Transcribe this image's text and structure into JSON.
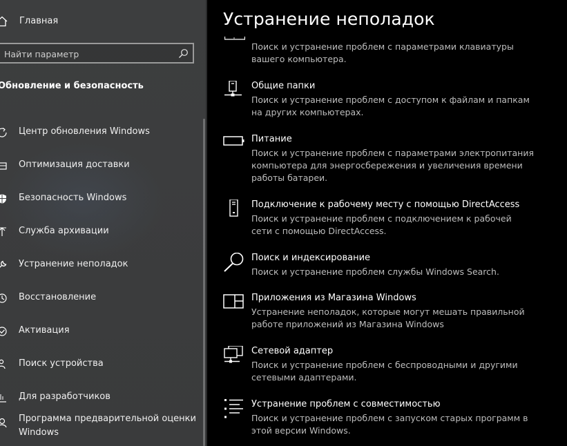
{
  "sidebar": {
    "home_label": "Главная",
    "search_placeholder": "Найти параметр",
    "section_title": "Обновление и безопасность",
    "items": [
      {
        "label": "Центр обновления Windows",
        "icon": "refresh-icon"
      },
      {
        "label": "Оптимизация доставки",
        "icon": "delivery-optimization-icon"
      },
      {
        "label": "Безопасность Windows",
        "icon": "shield-icon"
      },
      {
        "label": "Служба архивации",
        "icon": "backup-arrow-icon"
      },
      {
        "label": "Устранение неполадок",
        "icon": "wrench-icon"
      },
      {
        "label": "Восстановление",
        "icon": "recovery-icon"
      },
      {
        "label": "Активация",
        "icon": "check-circle-icon"
      },
      {
        "label": "Поиск устройства",
        "icon": "person-location-icon"
      },
      {
        "label": "Для разработчиков",
        "icon": "developer-icon"
      },
      {
        "label": "Программа предварительной оценки Windows",
        "icon": "insider-icon"
      }
    ]
  },
  "main": {
    "title": "Устранение неполадок",
    "top_description": "Поиск и устранение проблем с параметрами клавиатуры вашего компьютера.",
    "troubleshooters": [
      {
        "title": "Общие папки",
        "description": "Поиск и устранение проблем с доступом к файлам и папкам на других компьютерах.",
        "icon": "shared-folders-icon"
      },
      {
        "title": "Питание",
        "description": "Поиск и устранение проблем с параметрами электропитания компьютера для энергосбережения и увеличения  времени работы батареи.",
        "icon": "battery-icon"
      },
      {
        "title": "Подключение к рабочему месту с помощью DirectAccess",
        "description": "Поиск и устранение проблем с подключением к рабочей сети с помощью DirectAccess.",
        "icon": "directaccess-icon"
      },
      {
        "title": "Поиск и индексирование",
        "description": "Поиск и устранение проблем службы Windows Search.",
        "icon": "search-icon"
      },
      {
        "title": "Приложения из Магазина Windows",
        "description": "Устранение неполадок, которые могут мешать правильной работе приложений из Магазина Windows",
        "icon": "store-apps-icon"
      },
      {
        "title": "Сетевой адаптер",
        "description": "Поиск и устранение проблем с беспроводными и другими сетевыми адаптерами.",
        "icon": "network-adapter-icon"
      },
      {
        "title": "Устранение проблем с совместимостью",
        "description": "Поиск и устранение проблем с запуском старых программ в этой версии Windows.",
        "icon": "compatibility-icon"
      }
    ]
  }
}
